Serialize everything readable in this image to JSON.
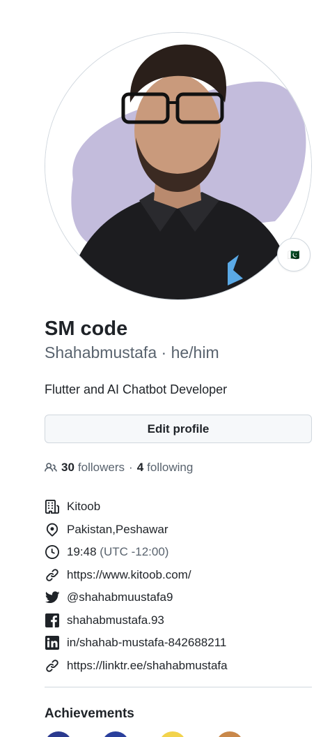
{
  "profile": {
    "display_name": "SM code",
    "username": "Shahabmustafa",
    "separator": " · ",
    "pronouns": "he/him",
    "bio": "Flutter and AI Chatbot Developer",
    "status_flag": "🇵🇰"
  },
  "edit_button": {
    "label": "Edit profile"
  },
  "follow": {
    "followers_count": "30",
    "followers_label": "followers",
    "dot": "·",
    "following_count": "4",
    "following_label": "following"
  },
  "details": {
    "company": "Kitoob",
    "location": "Pakistan,Peshawar",
    "localtime": "19:48",
    "timezone": "(UTC -12:00)",
    "website": "https://www.kitoob.com/",
    "twitter": "@shahabmuustafa9",
    "facebook": "shahabmustafa.93",
    "linkedin": "in/shahab-mustafa-842688211",
    "link2": "https://linktr.ee/shahabmustafa"
  },
  "achievements": {
    "title": "Achievements"
  },
  "colors": {
    "text": "#1f2328",
    "muted": "#59636e",
    "border": "#d0d7de",
    "button_bg": "#f6f8fa",
    "avatar_blob": "#b8b0d6"
  },
  "icons": [
    "people-icon",
    "organization-icon",
    "location-icon",
    "clock-icon",
    "link-icon",
    "twitter-icon",
    "facebook-icon",
    "linkedin-icon"
  ]
}
